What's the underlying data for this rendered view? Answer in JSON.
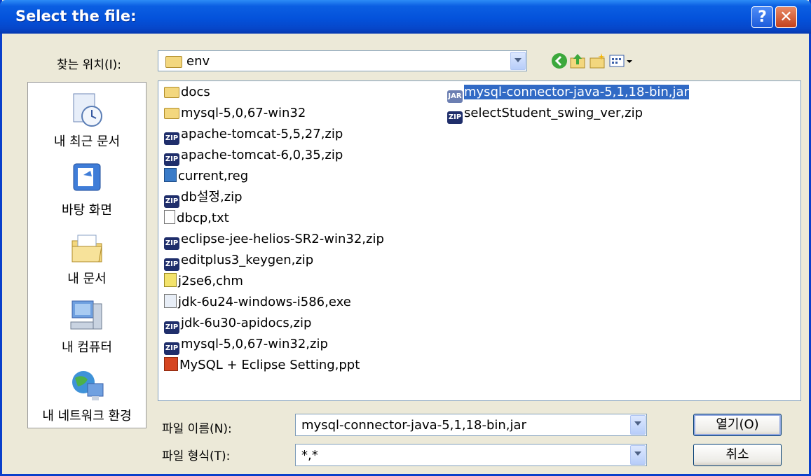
{
  "window": {
    "title": "Select the file:"
  },
  "toolbar": {
    "look_in_label": "찾는 위치(I):",
    "look_in_value": "env"
  },
  "places": [
    {
      "label": "내 최근 문서",
      "icon": "recent-documents-icon"
    },
    {
      "label": "바탕 화면",
      "icon": "desktop-icon"
    },
    {
      "label": "내 문서",
      "icon": "my-documents-icon"
    },
    {
      "label": "내 컴퓨터",
      "icon": "my-computer-icon"
    },
    {
      "label": "내 네트워크 환경",
      "icon": "my-network-icon"
    }
  ],
  "files": [
    {
      "name": "docs",
      "type": "folder"
    },
    {
      "name": "mysql-5,0,67-win32",
      "type": "folder"
    },
    {
      "name": "apache-tomcat-5,5,27,zip",
      "type": "zip"
    },
    {
      "name": "apache-tomcat-6,0,35,zip",
      "type": "zip"
    },
    {
      "name": "current,reg",
      "type": "reg"
    },
    {
      "name": "db설정,zip",
      "type": "zip"
    },
    {
      "name": "dbcp,txt",
      "type": "txt"
    },
    {
      "name": "eclipse-jee-helios-SR2-win32,zip",
      "type": "zip"
    },
    {
      "name": "editplus3_keygen,zip",
      "type": "zip"
    },
    {
      "name": "j2se6,chm",
      "type": "chm"
    },
    {
      "name": "jdk-6u24-windows-i586,exe",
      "type": "exe"
    },
    {
      "name": "jdk-6u30-apidocs,zip",
      "type": "zip"
    },
    {
      "name": "mysql-5,0,67-win32,zip",
      "type": "zip"
    },
    {
      "name": "MySQL + Eclipse Setting,ppt",
      "type": "ppt"
    },
    {
      "name": "mysql-connector-java-5,1,18-bin,jar",
      "type": "jar",
      "selected": true
    },
    {
      "name": "selectStudent_swing_ver,zip",
      "type": "zip"
    }
  ],
  "filename": {
    "label": "파일 이름(N):",
    "value": "mysql-connector-java-5,1,18-bin,jar"
  },
  "filetype": {
    "label": "파일 형식(T):",
    "value": "*,*"
  },
  "buttons": {
    "open": "열기(O)",
    "cancel": "취소"
  },
  "colors": {
    "titlebar": "#0452DB",
    "selection": "#316AC5",
    "dialog_bg": "#ECE9D8"
  }
}
